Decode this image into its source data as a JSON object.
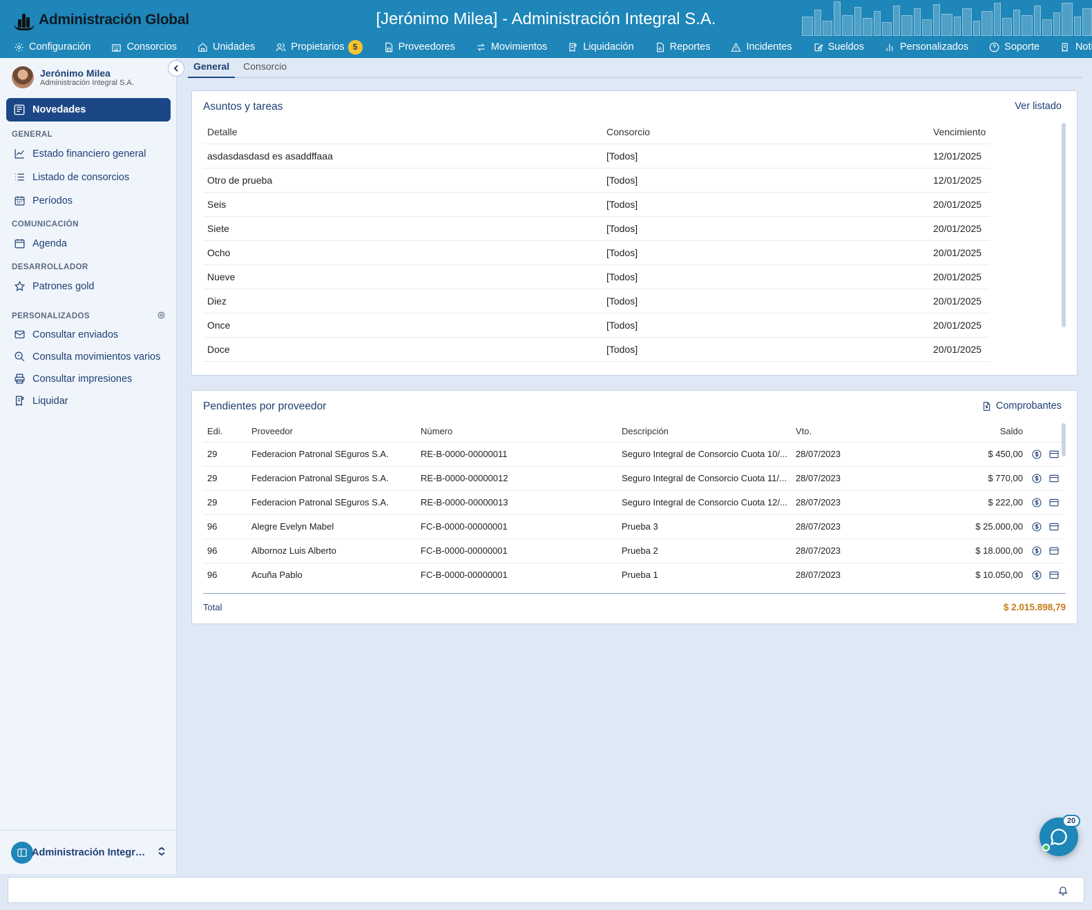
{
  "header": {
    "logo_text": "Administración Global",
    "title": "[Jerónimo Milea] - Administración Integral S.A."
  },
  "nav": [
    {
      "label": "Configuración",
      "icon": "gear-icon"
    },
    {
      "label": "Consorcios",
      "icon": "building-icon"
    },
    {
      "label": "Unidades",
      "icon": "home-icon"
    },
    {
      "label": "Propietarios",
      "icon": "users-icon",
      "badge": "5"
    },
    {
      "label": "Proveedores",
      "icon": "file-building-icon"
    },
    {
      "label": "Movimientos",
      "icon": "arrows-swap-icon"
    },
    {
      "label": "Liquidación",
      "icon": "receipt-icon"
    },
    {
      "label": "Reportes",
      "icon": "report-icon"
    },
    {
      "label": "Incidentes",
      "icon": "warning-icon"
    },
    {
      "label": "Sueldos",
      "icon": "edit-doc-icon"
    },
    {
      "label": "Personalizados",
      "icon": "bars-chart-icon"
    },
    {
      "label": "Soporte",
      "icon": "help-icon"
    },
    {
      "label": "Notificar",
      "icon": "receipt-icon"
    }
  ],
  "user": {
    "name": "Jerónimo Milea",
    "company": "Administración Integral S.A."
  },
  "sidebar": {
    "active_label": "Novedades",
    "sections": {
      "general": "GENERAL",
      "comunicacion": "COMUNICACIÓN",
      "desarrollador": "DESARROLLADOR",
      "personalizados": "PERSONALIZADOS"
    },
    "items": {
      "estado": "Estado financiero general",
      "listado": "Listado de consorcios",
      "periodos": "Períodos",
      "agenda": "Agenda",
      "patrones": "Patrones gold",
      "enviados": "Consultar enviados",
      "movimientos": "Consulta movimientos varios",
      "impresiones": "Consultar impresiones",
      "liquidar": "Liquidar"
    },
    "footer_label": "Administración Integral S.A."
  },
  "tabs": [
    "General",
    "Consorcio"
  ],
  "tasks": {
    "title": "Asuntos y tareas",
    "link": "Ver listado",
    "headers": [
      "Detalle",
      "Consorcio",
      "Vencimiento"
    ],
    "rows": [
      [
        "asdasdasdasd es asaddffaaa",
        "[Todos]",
        "12/01/2025"
      ],
      [
        "Otro de prueba",
        "[Todos]",
        "12/01/2025"
      ],
      [
        "Seis",
        "[Todos]",
        "20/01/2025"
      ],
      [
        "Siete",
        "[Todos]",
        "20/01/2025"
      ],
      [
        "Ocho",
        "[Todos]",
        "20/01/2025"
      ],
      [
        "Nueve",
        "[Todos]",
        "20/01/2025"
      ],
      [
        "Diez",
        "[Todos]",
        "20/01/2025"
      ],
      [
        "Once",
        "[Todos]",
        "20/01/2025"
      ],
      [
        "Doce",
        "[Todos]",
        "20/01/2025"
      ]
    ]
  },
  "pending": {
    "title": "Pendientes por proveedor",
    "link": "Comprobantes",
    "headers": [
      "Edi.",
      "Proveedor",
      "Número",
      "Descripción",
      "Vto.",
      "Saldo"
    ],
    "rows": [
      [
        "29",
        "Federacion Patronal SEguros S.A.",
        "RE-B-0000-00000011",
        "Seguro Integral de Consorcio Cuota 10/...",
        "28/07/2023",
        "$ 450,00"
      ],
      [
        "29",
        "Federacion Patronal SEguros S.A.",
        "RE-B-0000-00000012",
        "Seguro Integral de Consorcio Cuota 11/...",
        "28/07/2023",
        "$ 770,00"
      ],
      [
        "29",
        "Federacion Patronal SEguros S.A.",
        "RE-B-0000-00000013",
        "Seguro Integral de Consorcio Cuota 12/...",
        "28/07/2023",
        "$ 222,00"
      ],
      [
        "96",
        "Alegre Evelyn Mabel",
        "FC-B-0000-00000001",
        "Prueba 3",
        "28/07/2023",
        "$ 25.000,00"
      ],
      [
        "96",
        "Albornoz Luis Alberto",
        "FC-B-0000-00000001",
        "Prueba 2",
        "28/07/2023",
        "$ 18.000,00"
      ],
      [
        "96",
        "Acuña Pablo",
        "FC-B-0000-00000001",
        "Prueba 1",
        "28/07/2023",
        "$ 10.050,00"
      ]
    ],
    "total_label": "Total",
    "total_value": "$ 2.015.898,79"
  },
  "chat": {
    "badge": "20"
  },
  "colors": {
    "primary": "#1e86b8",
    "active": "#1c4787",
    "text_dark": "#1e3f73",
    "total": "#c77a1a",
    "badge": "#f4c430"
  }
}
